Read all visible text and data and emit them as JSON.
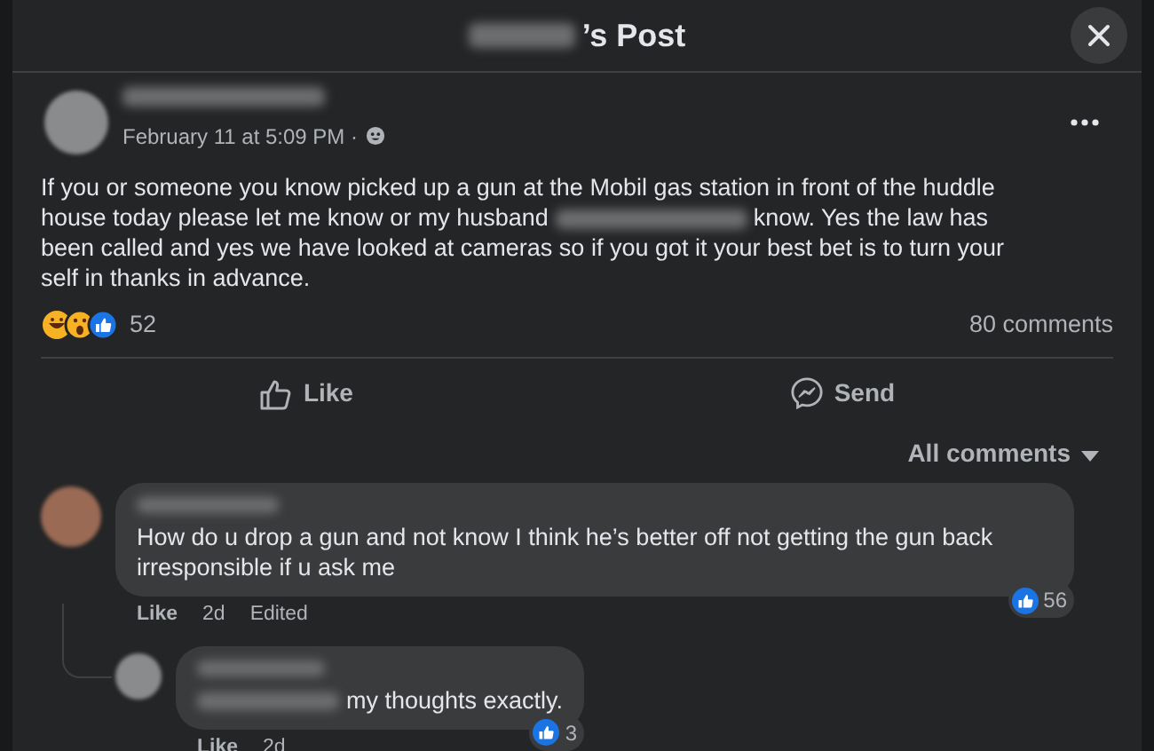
{
  "header": {
    "title": "’s Post"
  },
  "post": {
    "date": "February 11 at 5:09 PM ·",
    "text_before": "If you or someone you know picked up a gun at the Mobil gas station in front of the huddle house today please let me know or my husband",
    "text_after": "know. Yes the law has been called and yes we have looked at cameras so if you got it your best bet is to turn your self in thanks in advance.",
    "reaction_count": "52",
    "comment_count": "80 comments"
  },
  "actions": [
    {
      "kind": "like",
      "label": "Like"
    },
    {
      "kind": "send",
      "label": "Send"
    }
  ],
  "sort": "All comments",
  "comments": [
    {
      "text": "How do u drop a gun and not know I think he’s better off not getting the gun back irresponsible if u ask me",
      "mention": false,
      "reaction_count": "56",
      "meta": [
        "Like",
        "2d",
        "Edited"
      ],
      "children": [
        {
          "text": "my thoughts exactly.",
          "mention": true,
          "reaction_count": "3",
          "meta": [
            "Like",
            "2d"
          ]
        }
      ]
    }
  ]
}
